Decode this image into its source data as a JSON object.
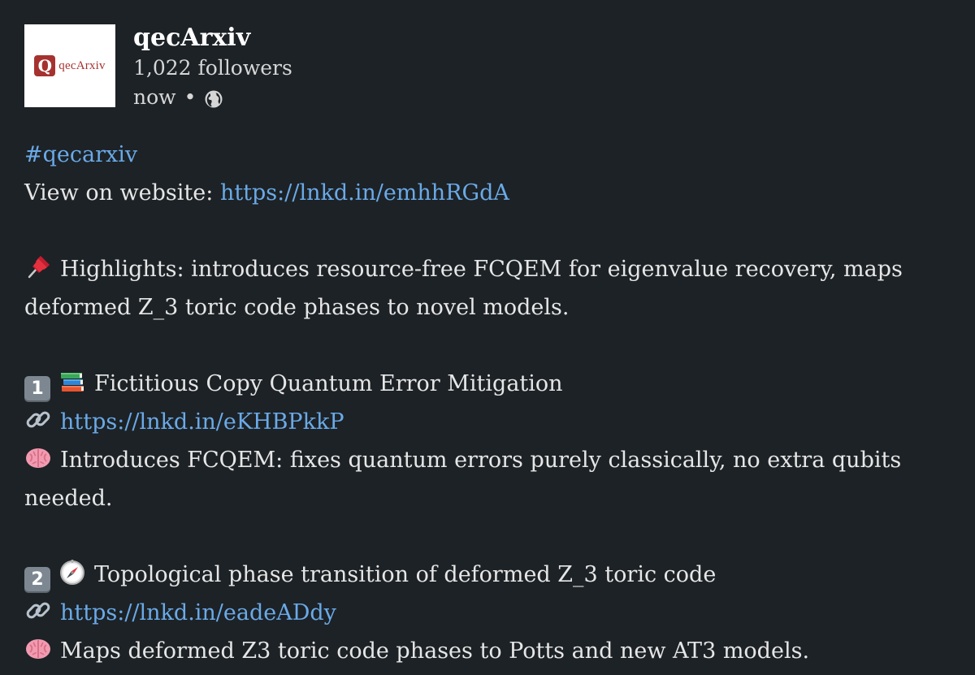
{
  "author": {
    "logo_letter": "Q",
    "logo_text": "qecArxiv",
    "name": "qecArxiv",
    "followers": "1,022 followers",
    "time": "now",
    "separator": "•",
    "visibility_icon": "globe-icon"
  },
  "post": {
    "hashtag": "#qecarxiv",
    "view_label": "View on website: ",
    "view_link": "https://lnkd.in/emhhRGdA",
    "highlights_icon": "pushpin-icon",
    "highlights_line1": "Highlights: introduces resource-free FCQEM for eigenvalue recovery, maps",
    "highlights_line2": "deformed Z_3 toric code phases to novel models.",
    "items": [
      {
        "number": "1",
        "topic_icon": "books-icon",
        "title": "Fictitious Copy Quantum Error Mitigation",
        "link_icon": "link-icon",
        "link": "https://lnkd.in/eKHBPkkP",
        "summary_icon": "brain-icon",
        "summary_line1": "Introduces FCQEM: fixes quantum errors purely classically, no extra qubits",
        "summary_line2": "needed."
      },
      {
        "number": "2",
        "topic_icon": "compass-icon",
        "title": "Topological phase transition of deformed Z_3 toric code",
        "link_icon": "link-icon",
        "link": "https://lnkd.in/eadeADdy",
        "summary_icon": "brain-icon",
        "summary_line1": "Maps deformed Z3 toric code phases to Potts and new AT3 models."
      }
    ]
  },
  "colors": {
    "background": "#1d2226",
    "link": "#6aaae8",
    "logo_brand": "#a5322f",
    "text": "#e6e6e6"
  }
}
